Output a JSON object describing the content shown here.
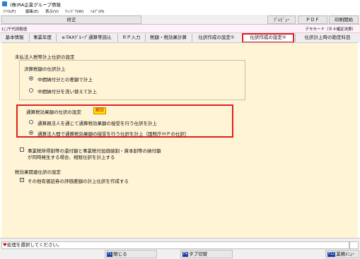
{
  "window": {
    "title": "(株)RA企業グループ情報"
  },
  "menu": [
    "ﾌｧｲﾙ(F)",
    "編集(E)",
    "表示(V)",
    "ｳｨﾝﾄﾞｳ(W)",
    "ﾍﾙﾌﾟ(H)"
  ],
  "toolbar": {
    "fix": "修正",
    "preview": "ﾌﾟﾚﾋﾞｭｰ",
    "pdf": "ＰＤＦ",
    "print": "印刷開始"
  },
  "header": {
    "company": "1□千代田製造",
    "mode": "デモモード（Ｒ４確定決算）"
  },
  "tabs": [
    "基本情報",
    "事業年度",
    "e-TAXｸﾞﾙｰﾌﾟ通算等読込",
    "ＲＰ入力",
    "税額・税効果計算",
    "仕訳作成の設定①",
    "仕訳作成の設定②",
    "仕訳計上時の勘定科目"
  ],
  "section1": {
    "title": "未払法人税等計上仕訳の設定",
    "group_title": "決算税額の仕訳計上",
    "options": [
      "中間納付分との差額で計上",
      "中間納付分を洗い替えて計上"
    ],
    "selected": 0
  },
  "section2": {
    "title": "通算税効果額の仕訳の設定",
    "help_badge": "解説",
    "options": [
      "通算親法人を通じて通算税効果額の授受を行う仕訳を計上",
      "通算法人間で通算税効果額の授受を行う仕訳を計上（国税庁ＨＰの仕訳）"
    ],
    "selected": 1
  },
  "checkbox1": {
    "line1": "事業税所得割等の還付額と事業税付加価値割・資本割等の納付額",
    "line2": "が同時発生する場合、相殺仕訳を計上する",
    "checked": false
  },
  "section3": {
    "title": "税効果関連仕訳の設定",
    "check_label": "その他有価証券の評価差額の計上仕訳を作成する",
    "checked": true
  },
  "status": {
    "message": "処理を選択してください。"
  },
  "fkeys": [
    {
      "num": "F1",
      "label": "閉じる"
    },
    {
      "num": "F4",
      "label": "タブ切替"
    },
    {
      "num": "F12",
      "label": "業務ﾒﾆｭｰ"
    }
  ],
  "colors": {
    "panel_bg": "#fff4d6",
    "header_bg": "#fff0fa",
    "highlight": "#e02020"
  }
}
